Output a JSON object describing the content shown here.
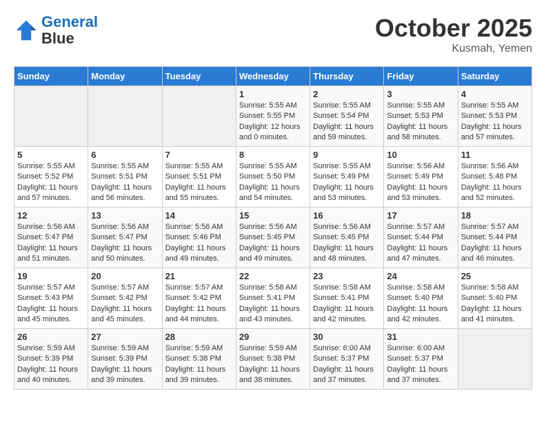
{
  "logo": {
    "line1": "General",
    "line2": "Blue"
  },
  "title": "October 2025",
  "location": "Kusmah, Yemen",
  "days_of_week": [
    "Sunday",
    "Monday",
    "Tuesday",
    "Wednesday",
    "Thursday",
    "Friday",
    "Saturday"
  ],
  "weeks": [
    [
      {
        "day": "",
        "sunrise": "",
        "sunset": "",
        "daylight": ""
      },
      {
        "day": "",
        "sunrise": "",
        "sunset": "",
        "daylight": ""
      },
      {
        "day": "",
        "sunrise": "",
        "sunset": "",
        "daylight": ""
      },
      {
        "day": "1",
        "sunrise": "Sunrise: 5:55 AM",
        "sunset": "Sunset: 5:55 PM",
        "daylight": "Daylight: 12 hours and 0 minutes."
      },
      {
        "day": "2",
        "sunrise": "Sunrise: 5:55 AM",
        "sunset": "Sunset: 5:54 PM",
        "daylight": "Daylight: 11 hours and 59 minutes."
      },
      {
        "day": "3",
        "sunrise": "Sunrise: 5:55 AM",
        "sunset": "Sunset: 5:53 PM",
        "daylight": "Daylight: 11 hours and 58 minutes."
      },
      {
        "day": "4",
        "sunrise": "Sunrise: 5:55 AM",
        "sunset": "Sunset: 5:53 PM",
        "daylight": "Daylight: 11 hours and 57 minutes."
      }
    ],
    [
      {
        "day": "5",
        "sunrise": "Sunrise: 5:55 AM",
        "sunset": "Sunset: 5:52 PM",
        "daylight": "Daylight: 11 hours and 57 minutes."
      },
      {
        "day": "6",
        "sunrise": "Sunrise: 5:55 AM",
        "sunset": "Sunset: 5:51 PM",
        "daylight": "Daylight: 11 hours and 56 minutes."
      },
      {
        "day": "7",
        "sunrise": "Sunrise: 5:55 AM",
        "sunset": "Sunset: 5:51 PM",
        "daylight": "Daylight: 11 hours and 55 minutes."
      },
      {
        "day": "8",
        "sunrise": "Sunrise: 5:55 AM",
        "sunset": "Sunset: 5:50 PM",
        "daylight": "Daylight: 11 hours and 54 minutes."
      },
      {
        "day": "9",
        "sunrise": "Sunrise: 5:55 AM",
        "sunset": "Sunset: 5:49 PM",
        "daylight": "Daylight: 11 hours and 53 minutes."
      },
      {
        "day": "10",
        "sunrise": "Sunrise: 5:56 AM",
        "sunset": "Sunset: 5:49 PM",
        "daylight": "Daylight: 11 hours and 53 minutes."
      },
      {
        "day": "11",
        "sunrise": "Sunrise: 5:56 AM",
        "sunset": "Sunset: 5:48 PM",
        "daylight": "Daylight: 11 hours and 52 minutes."
      }
    ],
    [
      {
        "day": "12",
        "sunrise": "Sunrise: 5:56 AM",
        "sunset": "Sunset: 5:47 PM",
        "daylight": "Daylight: 11 hours and 51 minutes."
      },
      {
        "day": "13",
        "sunrise": "Sunrise: 5:56 AM",
        "sunset": "Sunset: 5:47 PM",
        "daylight": "Daylight: 11 hours and 50 minutes."
      },
      {
        "day": "14",
        "sunrise": "Sunrise: 5:56 AM",
        "sunset": "Sunset: 5:46 PM",
        "daylight": "Daylight: 11 hours and 49 minutes."
      },
      {
        "day": "15",
        "sunrise": "Sunrise: 5:56 AM",
        "sunset": "Sunset: 5:45 PM",
        "daylight": "Daylight: 11 hours and 49 minutes."
      },
      {
        "day": "16",
        "sunrise": "Sunrise: 5:56 AM",
        "sunset": "Sunset: 5:45 PM",
        "daylight": "Daylight: 11 hours and 48 minutes."
      },
      {
        "day": "17",
        "sunrise": "Sunrise: 5:57 AM",
        "sunset": "Sunset: 5:44 PM",
        "daylight": "Daylight: 11 hours and 47 minutes."
      },
      {
        "day": "18",
        "sunrise": "Sunrise: 5:57 AM",
        "sunset": "Sunset: 5:44 PM",
        "daylight": "Daylight: 11 hours and 46 minutes."
      }
    ],
    [
      {
        "day": "19",
        "sunrise": "Sunrise: 5:57 AM",
        "sunset": "Sunset: 5:43 PM",
        "daylight": "Daylight: 11 hours and 45 minutes."
      },
      {
        "day": "20",
        "sunrise": "Sunrise: 5:57 AM",
        "sunset": "Sunset: 5:42 PM",
        "daylight": "Daylight: 11 hours and 45 minutes."
      },
      {
        "day": "21",
        "sunrise": "Sunrise: 5:57 AM",
        "sunset": "Sunset: 5:42 PM",
        "daylight": "Daylight: 11 hours and 44 minutes."
      },
      {
        "day": "22",
        "sunrise": "Sunrise: 5:58 AM",
        "sunset": "Sunset: 5:41 PM",
        "daylight": "Daylight: 11 hours and 43 minutes."
      },
      {
        "day": "23",
        "sunrise": "Sunrise: 5:58 AM",
        "sunset": "Sunset: 5:41 PM",
        "daylight": "Daylight: 11 hours and 42 minutes."
      },
      {
        "day": "24",
        "sunrise": "Sunrise: 5:58 AM",
        "sunset": "Sunset: 5:40 PM",
        "daylight": "Daylight: 11 hours and 42 minutes."
      },
      {
        "day": "25",
        "sunrise": "Sunrise: 5:58 AM",
        "sunset": "Sunset: 5:40 PM",
        "daylight": "Daylight: 11 hours and 41 minutes."
      }
    ],
    [
      {
        "day": "26",
        "sunrise": "Sunrise: 5:59 AM",
        "sunset": "Sunset: 5:39 PM",
        "daylight": "Daylight: 11 hours and 40 minutes."
      },
      {
        "day": "27",
        "sunrise": "Sunrise: 5:59 AM",
        "sunset": "Sunset: 5:39 PM",
        "daylight": "Daylight: 11 hours and 39 minutes."
      },
      {
        "day": "28",
        "sunrise": "Sunrise: 5:59 AM",
        "sunset": "Sunset: 5:38 PM",
        "daylight": "Daylight: 11 hours and 39 minutes."
      },
      {
        "day": "29",
        "sunrise": "Sunrise: 5:59 AM",
        "sunset": "Sunset: 5:38 PM",
        "daylight": "Daylight: 11 hours and 38 minutes."
      },
      {
        "day": "30",
        "sunrise": "Sunrise: 6:00 AM",
        "sunset": "Sunset: 5:37 PM",
        "daylight": "Daylight: 11 hours and 37 minutes."
      },
      {
        "day": "31",
        "sunrise": "Sunrise: 6:00 AM",
        "sunset": "Sunset: 5:37 PM",
        "daylight": "Daylight: 11 hours and 37 minutes."
      },
      {
        "day": "",
        "sunrise": "",
        "sunset": "",
        "daylight": ""
      }
    ]
  ]
}
